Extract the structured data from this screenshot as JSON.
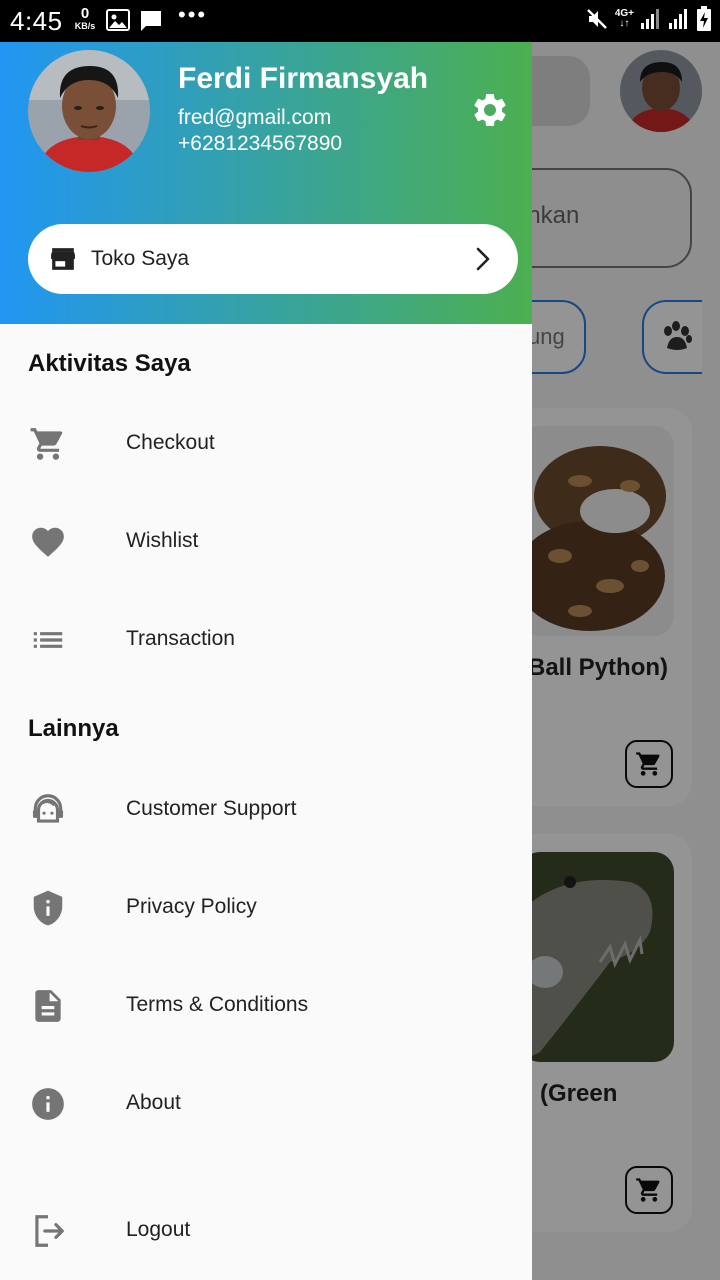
{
  "status_bar": {
    "time": "4:45",
    "net_speed_value": "0",
    "net_speed_unit": "KB/s",
    "network_type": "4G+",
    "icons": [
      "image-icon",
      "message-icon",
      "more-dots-icon",
      "mute-icon",
      "signal-icon",
      "signal-icon",
      "battery-charging-icon"
    ]
  },
  "background": {
    "search_placeholder_fragment": "inkan",
    "chip_fragment": "ung",
    "card1_title_fragment": "Ball Python)",
    "card2_title_fragment": "(Green",
    "icons": [
      "paw-icon",
      "cart-icon"
    ]
  },
  "drawer": {
    "user": {
      "name": "Ferdi Firmansyah",
      "email": "fred@gmail.com",
      "phone": "+6281234567890"
    },
    "store_button": {
      "label": "Toko Saya",
      "icon": "store-icon"
    },
    "sections": [
      {
        "title": "Aktivitas Saya",
        "items": [
          {
            "label": "Checkout",
            "icon": "cart-icon"
          },
          {
            "label": "Wishlist",
            "icon": "heart-icon"
          },
          {
            "label": "Transaction",
            "icon": "list-icon"
          }
        ]
      },
      {
        "title": "Lainnya",
        "items": [
          {
            "label": "Customer Support",
            "icon": "support-agent-icon"
          },
          {
            "label": "Privacy Policy",
            "icon": "shield-icon"
          },
          {
            "label": "Terms & Conditions",
            "icon": "document-icon"
          },
          {
            "label": "About",
            "icon": "info-icon"
          },
          {
            "label": "Logout",
            "icon": "logout-icon"
          }
        ]
      }
    ]
  },
  "colors": {
    "header_gradient_start": "#2196f3",
    "header_gradient_end": "#4caf50",
    "drawer_background": "#fafafa",
    "icon_gray": "#757575",
    "chip_border": "#2a7de1"
  }
}
